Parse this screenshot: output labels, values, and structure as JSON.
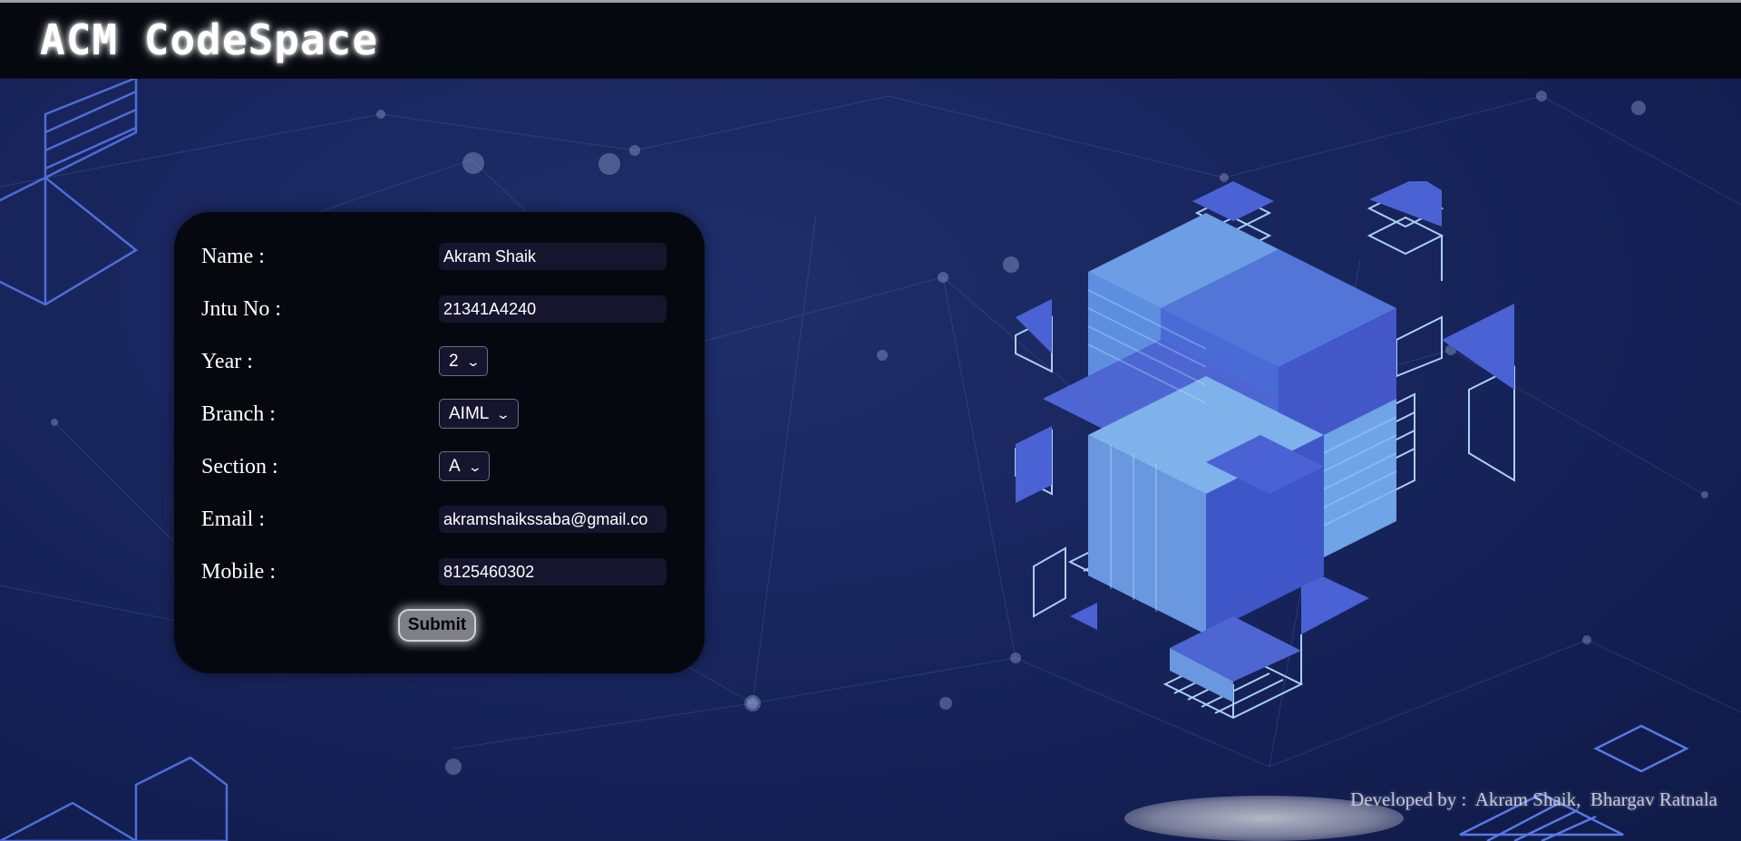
{
  "header": {
    "title": "ACM CodeSpace"
  },
  "form": {
    "fields": [
      {
        "label": "Name :",
        "value": "Akram Shaik"
      },
      {
        "label": "Jntu No :",
        "value": "21341A4240"
      },
      {
        "label": "Year :",
        "value": "2"
      },
      {
        "label": "Branch :",
        "value": "AIML"
      },
      {
        "label": "Section :",
        "value": "A"
      },
      {
        "label": "Email :",
        "value": "akramshaikssaba@gmail.co"
      },
      {
        "label": "Mobile :",
        "value": "8125460302"
      }
    ],
    "submit_label": "Submit"
  },
  "footer": {
    "credit": "Developed by :  Akram Shaik,  Bhargav Ratnala"
  },
  "colors": {
    "background": "#182558",
    "header": "#05080f",
    "card": "#06080f",
    "input": "#15162e",
    "accent_blue": "#3f55c8"
  }
}
